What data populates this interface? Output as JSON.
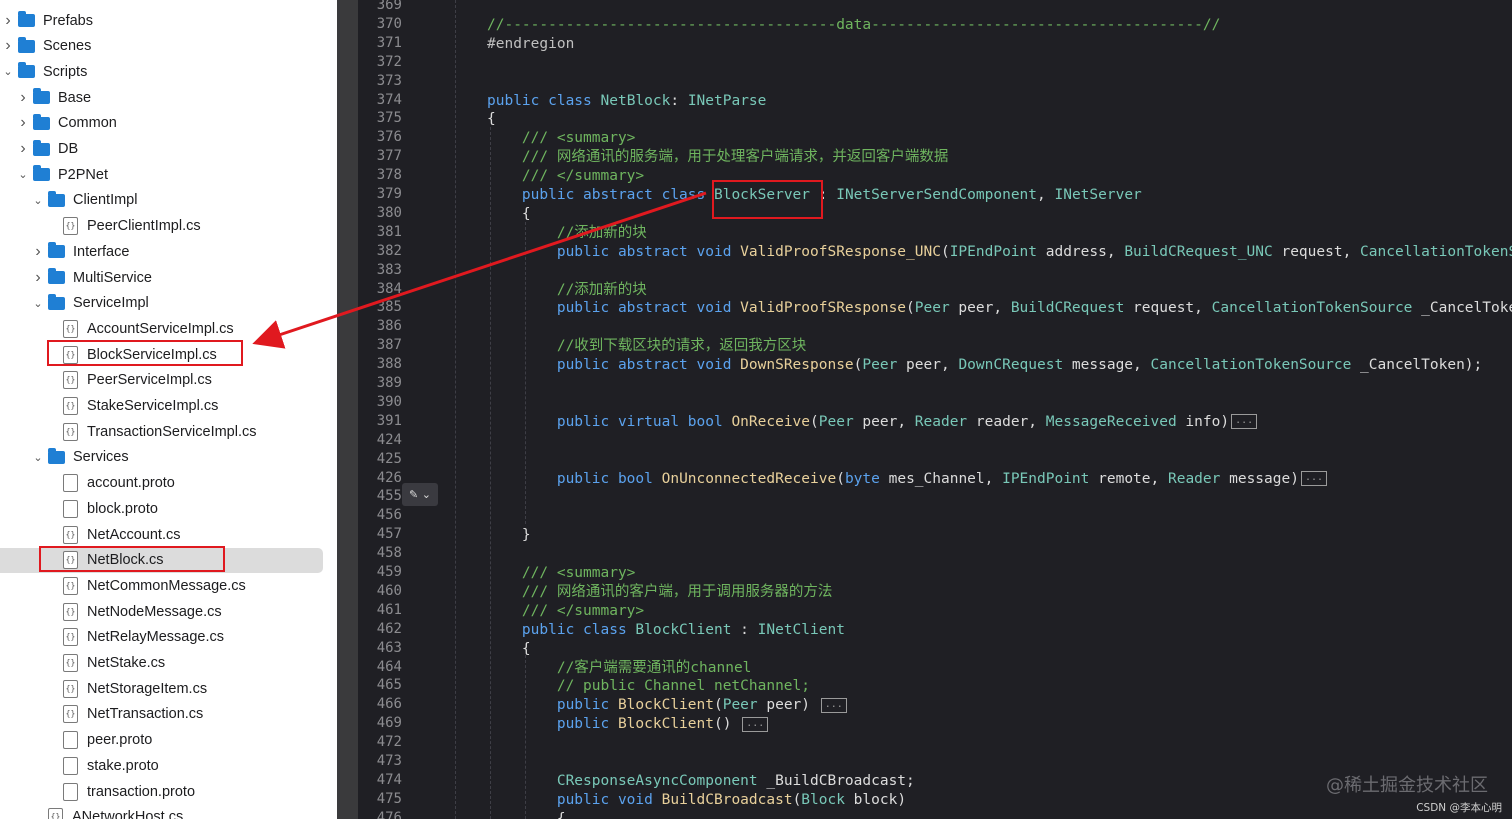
{
  "tree": [
    {
      "label": "Prefabs",
      "depth": 0,
      "kind": "folder",
      "chev": "right"
    },
    {
      "label": "Scenes",
      "depth": 0,
      "kind": "folder",
      "chev": "right"
    },
    {
      "label": "Scripts",
      "depth": 0,
      "kind": "folder",
      "chev": "down"
    },
    {
      "label": "Base",
      "depth": 1,
      "kind": "folder",
      "chev": "right"
    },
    {
      "label": "Common",
      "depth": 1,
      "kind": "folder",
      "chev": "right"
    },
    {
      "label": "DB",
      "depth": 1,
      "kind": "folder",
      "chev": "right"
    },
    {
      "label": "P2PNet",
      "depth": 1,
      "kind": "folder",
      "chev": "down"
    },
    {
      "label": "ClientImpl",
      "depth": 2,
      "kind": "folder",
      "chev": "down"
    },
    {
      "label": "PeerClientImpl.cs",
      "depth": 3,
      "kind": "cs"
    },
    {
      "label": "Interface",
      "depth": 2,
      "kind": "folder",
      "chev": "right"
    },
    {
      "label": "MultiService",
      "depth": 2,
      "kind": "folder",
      "chev": "right"
    },
    {
      "label": "ServiceImpl",
      "depth": 2,
      "kind": "folder",
      "chev": "down"
    },
    {
      "label": "AccountServiceImpl.cs",
      "depth": 3,
      "kind": "cs"
    },
    {
      "label": "BlockServiceImpl.cs",
      "depth": 3,
      "kind": "cs",
      "boxed": true
    },
    {
      "label": "PeerServiceImpl.cs",
      "depth": 3,
      "kind": "cs"
    },
    {
      "label": "StakeServiceImpl.cs",
      "depth": 3,
      "kind": "cs"
    },
    {
      "label": "TransactionServiceImpl.cs",
      "depth": 3,
      "kind": "cs"
    },
    {
      "label": "Services",
      "depth": 2,
      "kind": "folder",
      "chev": "down"
    },
    {
      "label": "account.proto",
      "depth": 3,
      "kind": "file"
    },
    {
      "label": "block.proto",
      "depth": 3,
      "kind": "file"
    },
    {
      "label": "NetAccount.cs",
      "depth": 3,
      "kind": "cs"
    },
    {
      "label": "NetBlock.cs",
      "depth": 3,
      "kind": "cs",
      "selected": true,
      "boxed": true
    },
    {
      "label": "NetCommonMessage.cs",
      "depth": 3,
      "kind": "cs"
    },
    {
      "label": "NetNodeMessage.cs",
      "depth": 3,
      "kind": "cs"
    },
    {
      "label": "NetRelayMessage.cs",
      "depth": 3,
      "kind": "cs"
    },
    {
      "label": "NetStake.cs",
      "depth": 3,
      "kind": "cs"
    },
    {
      "label": "NetStorageItem.cs",
      "depth": 3,
      "kind": "cs"
    },
    {
      "label": "NetTransaction.cs",
      "depth": 3,
      "kind": "cs"
    },
    {
      "label": "peer.proto",
      "depth": 3,
      "kind": "file"
    },
    {
      "label": "stake.proto",
      "depth": 3,
      "kind": "file"
    },
    {
      "label": "transaction.proto",
      "depth": 3,
      "kind": "file"
    },
    {
      "label": "ANetworkHost.cs",
      "depth": 2,
      "kind": "cs"
    }
  ],
  "code": [
    {
      "n": "369",
      "t": []
    },
    {
      "n": "370",
      "t": [
        [
          "cm",
          "//--------------------------------------data--------------------------------------//"
        ]
      ]
    },
    {
      "n": "371",
      "t": [
        [
          "pp",
          "#endregion"
        ]
      ]
    },
    {
      "n": "372",
      "t": []
    },
    {
      "n": "373",
      "t": []
    },
    {
      "n": "374",
      "t": [
        [
          "kw",
          "public class "
        ],
        [
          "ty",
          "NetBlock"
        ],
        [
          "pa",
          ": "
        ],
        [
          "ty",
          "INetParse"
        ]
      ]
    },
    {
      "n": "375",
      "t": [
        [
          "pa",
          "{"
        ]
      ]
    },
    {
      "n": "376",
      "t": [
        [
          "cm",
          "    /// <summary>"
        ]
      ]
    },
    {
      "n": "377",
      "t": [
        [
          "cm",
          "    /// 网络通讯的服务端，用于处理客户端请求，并返回客户端数据"
        ]
      ]
    },
    {
      "n": "378",
      "t": [
        [
          "cm",
          "    /// </summary>"
        ]
      ]
    },
    {
      "n": "379",
      "t": [
        [
          "kw",
          "    public abstract class "
        ],
        [
          "ty",
          "BlockServer"
        ],
        [
          "pa",
          " : "
        ],
        [
          "ty",
          "INetServerSendComponent"
        ],
        [
          "pa",
          ", "
        ],
        [
          "ty",
          "INetServer"
        ]
      ]
    },
    {
      "n": "380",
      "t": [
        [
          "pa",
          "    {"
        ]
      ]
    },
    {
      "n": "381",
      "t": [
        [
          "cm",
          "        //添加新的块"
        ]
      ]
    },
    {
      "n": "382",
      "t": [
        [
          "kw",
          "        public abstract void "
        ],
        [
          "fn",
          "ValidProofSResponse_UNC"
        ],
        [
          "pa",
          "("
        ],
        [
          "ty",
          "IPEndPoint"
        ],
        [
          "pa",
          " address, "
        ],
        [
          "ty",
          "BuildCRequest_UNC"
        ],
        [
          "pa",
          " request, "
        ],
        [
          "ty",
          "CancellationTokenSource"
        ]
      ]
    },
    {
      "n": "383",
      "t": []
    },
    {
      "n": "384",
      "t": [
        [
          "cm",
          "        //添加新的块"
        ]
      ]
    },
    {
      "n": "385",
      "t": [
        [
          "kw",
          "        public abstract void "
        ],
        [
          "fn",
          "ValidProofSResponse"
        ],
        [
          "pa",
          "("
        ],
        [
          "ty",
          "Peer"
        ],
        [
          "pa",
          " peer, "
        ],
        [
          "ty",
          "BuildCRequest"
        ],
        [
          "pa",
          " request, "
        ],
        [
          "ty",
          "CancellationTokenSource"
        ],
        [
          "pa",
          " _CancelToken);"
        ]
      ]
    },
    {
      "n": "386",
      "t": []
    },
    {
      "n": "387",
      "t": [
        [
          "cm",
          "        //收到下载区块的请求，返回我方区块"
        ]
      ]
    },
    {
      "n": "388",
      "t": [
        [
          "kw",
          "        public abstract void "
        ],
        [
          "fn",
          "DownSResponse"
        ],
        [
          "pa",
          "("
        ],
        [
          "ty",
          "Peer"
        ],
        [
          "pa",
          " peer, "
        ],
        [
          "ty",
          "DownCRequest"
        ],
        [
          "pa",
          " message, "
        ],
        [
          "ty",
          "CancellationTokenSource"
        ],
        [
          "pa",
          " _CancelToken);"
        ]
      ]
    },
    {
      "n": "389",
      "t": []
    },
    {
      "n": "390",
      "t": []
    },
    {
      "n": "391",
      "t": [
        [
          "kw",
          "        public virtual bool "
        ],
        [
          "fn",
          "OnReceive"
        ],
        [
          "pa",
          "("
        ],
        [
          "ty",
          "Peer"
        ],
        [
          "pa",
          " peer, "
        ],
        [
          "ty",
          "Reader"
        ],
        [
          "pa",
          " reader, "
        ],
        [
          "ty",
          "MessageReceived"
        ],
        [
          "pa",
          " info)"
        ],
        [
          "fold",
          "..."
        ]
      ]
    },
    {
      "n": "424",
      "t": []
    },
    {
      "n": "425",
      "t": []
    },
    {
      "n": "426",
      "t": [
        [
          "kw",
          "        public bool "
        ],
        [
          "fn",
          "OnUnconnectedReceive"
        ],
        [
          "pa",
          "("
        ],
        [
          "kw",
          "byte"
        ],
        [
          "pa",
          " mes_Channel, "
        ],
        [
          "ty",
          "IPEndPoint"
        ],
        [
          "pa",
          " remote, "
        ],
        [
          "ty",
          "Reader"
        ],
        [
          "pa",
          " message)"
        ],
        [
          "fold",
          "..."
        ]
      ]
    },
    {
      "n": "455",
      "t": []
    },
    {
      "n": "456",
      "t": []
    },
    {
      "n": "457",
      "t": [
        [
          "pa",
          "    }"
        ]
      ]
    },
    {
      "n": "458",
      "t": []
    },
    {
      "n": "459",
      "t": [
        [
          "cm",
          "    /// <summary>"
        ]
      ]
    },
    {
      "n": "460",
      "t": [
        [
          "cm",
          "    /// 网络通讯的客户端，用于调用服务器的方法"
        ]
      ]
    },
    {
      "n": "461",
      "t": [
        [
          "cm",
          "    /// </summary>"
        ]
      ]
    },
    {
      "n": "462",
      "t": [
        [
          "kw",
          "    public class "
        ],
        [
          "ty",
          "BlockClient"
        ],
        [
          "pa",
          " : "
        ],
        [
          "ty",
          "INetClient"
        ]
      ]
    },
    {
      "n": "463",
      "t": [
        [
          "pa",
          "    {"
        ]
      ]
    },
    {
      "n": "464",
      "t": [
        [
          "cm",
          "        //客户端需要通讯的channel"
        ]
      ]
    },
    {
      "n": "465",
      "t": [
        [
          "cm",
          "        // public Channel netChannel;"
        ]
      ]
    },
    {
      "n": "466",
      "t": [
        [
          "kw",
          "        public "
        ],
        [
          "fn",
          "BlockClient"
        ],
        [
          "pa",
          "("
        ],
        [
          "ty",
          "Peer"
        ],
        [
          "pa",
          " peer) "
        ],
        [
          "fold",
          "..."
        ]
      ]
    },
    {
      "n": "469",
      "t": [
        [
          "kw",
          "        public "
        ],
        [
          "fn",
          "BlockClient"
        ],
        [
          "pa",
          "() "
        ],
        [
          "fold",
          "..."
        ]
      ]
    },
    {
      "n": "472",
      "t": []
    },
    {
      "n": "473",
      "t": []
    },
    {
      "n": "474",
      "t": [
        [
          "ty",
          "        CResponseAsyncComponent"
        ],
        [
          "pa",
          " _BuildCBroadcast;"
        ]
      ]
    },
    {
      "n": "475",
      "t": [
        [
          "kw",
          "        public void "
        ],
        [
          "fn",
          "BuildCBroadcast"
        ],
        [
          "pa",
          "("
        ],
        [
          "ty",
          "Block"
        ],
        [
          "pa",
          " block)"
        ]
      ]
    },
    {
      "n": "476",
      "t": [
        [
          "pa",
          "        {"
        ]
      ]
    }
  ],
  "watermark": "@稀土掘金技术社区",
  "credit": "CSDN @李本心明",
  "colors": {
    "accent_red": "#e0191f",
    "folder_blue": "#1f7fd4",
    "editor_bg": "#1f1f24"
  }
}
